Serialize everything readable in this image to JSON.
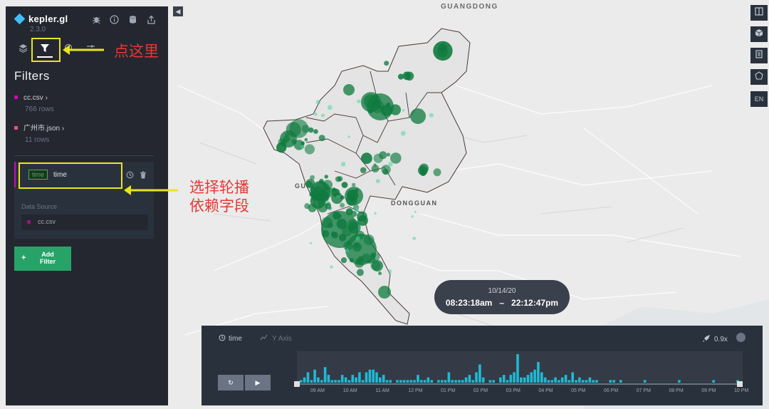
{
  "app": {
    "name": "kepler.gl",
    "version": "2.3.0"
  },
  "panel": {
    "title": "Filters",
    "datasets": [
      {
        "name": "cc.csv",
        "rows": "766 rows",
        "color": "#c20fb1"
      },
      {
        "name": "广州市.json",
        "rows": "11 rows",
        "color": "#e2557d"
      }
    ],
    "filter": {
      "type_tag": "time",
      "field": "time",
      "data_source_label": "Data Source",
      "data_source": "cc.csv"
    },
    "add_filter": {
      "icon": "+",
      "label": "Add Filter"
    }
  },
  "annotations": {
    "tab_hint": "点这里",
    "field_hint_1": "选择轮播",
    "field_hint_2": "依赖字段",
    "color": "#e53935",
    "highlight": "#e9e51c"
  },
  "map": {
    "labels": [
      "GUANGDONG",
      "DONGGUAN",
      "GU"
    ],
    "point_color": "#0e7a3e"
  },
  "right_toolbar": {
    "language": "EN"
  },
  "time_display": {
    "date": "10/14/20",
    "start": "08:23:18am",
    "dash": "–",
    "end": "22:12:47pm"
  },
  "timeline": {
    "field_label": "time",
    "y_axis_label": "Y Axis",
    "speed": "0.9x",
    "ticks": [
      "09 AM",
      "10 AM",
      "11 AM",
      "12 PM",
      "01 PM",
      "02 PM",
      "03 PM",
      "04 PM",
      "05 PM",
      "06 PM",
      "07 PM",
      "08 PM",
      "09 PM",
      "10 PM"
    ],
    "histogram": [
      1,
      2,
      4,
      1,
      5,
      2,
      1,
      6,
      3,
      1,
      1,
      1,
      3,
      2,
      1,
      3,
      2,
      4,
      1,
      4,
      5,
      5,
      4,
      2,
      3,
      1,
      1,
      0,
      1,
      1,
      1,
      1,
      1,
      1,
      3,
      1,
      1,
      2,
      1,
      0,
      1,
      1,
      1,
      4,
      1,
      1,
      1,
      1,
      2,
      3,
      1,
      4,
      7,
      2,
      0,
      1,
      1,
      0,
      2,
      3,
      1,
      3,
      4,
      11,
      2,
      2,
      3,
      4,
      5,
      8,
      4,
      2,
      1,
      1,
      2,
      1,
      2,
      3,
      1,
      4,
      1,
      2,
      1,
      1,
      2,
      1,
      1,
      0,
      0,
      0,
      1,
      1,
      0,
      1,
      0,
      0,
      0,
      0,
      0,
      0,
      1,
      0,
      0,
      0,
      0,
      0,
      0,
      0,
      0,
      0,
      1,
      0,
      0,
      0,
      0,
      0,
      0,
      0,
      0,
      0,
      1,
      0,
      0,
      0,
      0,
      0,
      0,
      1
    ],
    "bar_color": "#1fbad6"
  }
}
